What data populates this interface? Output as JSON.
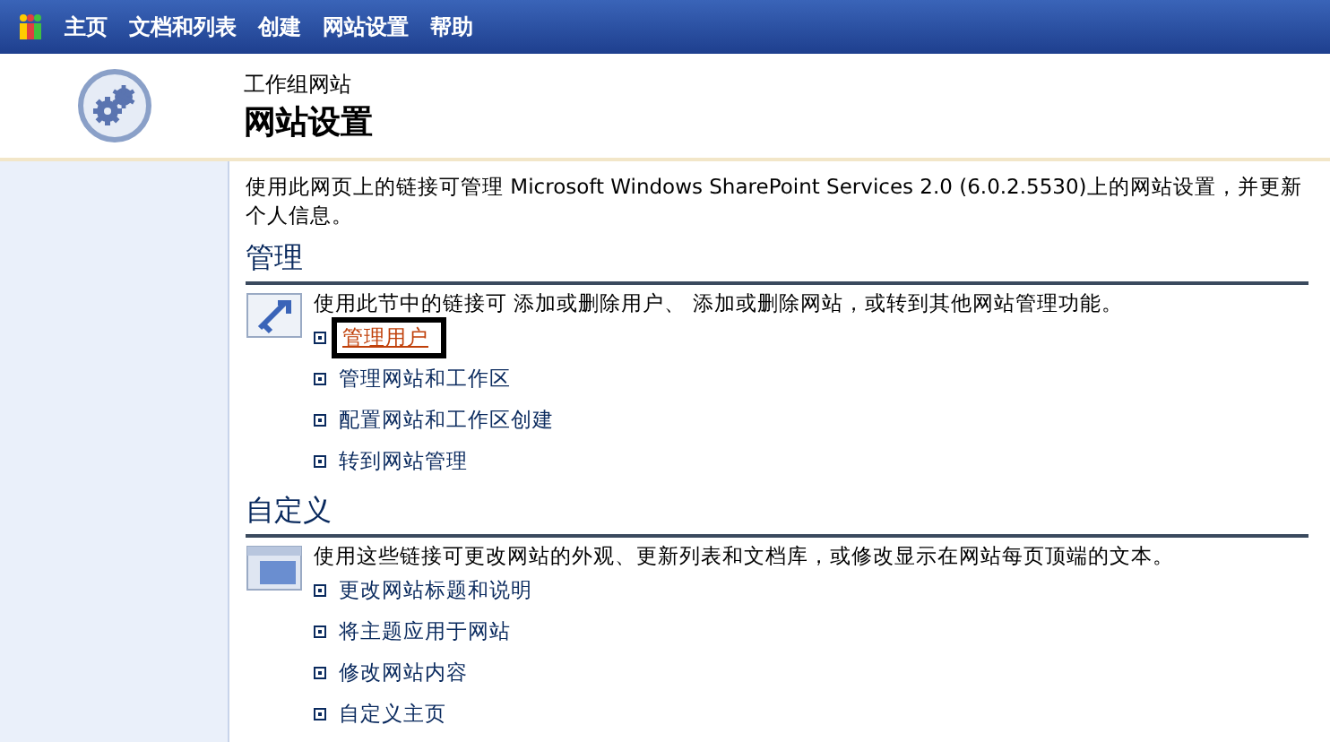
{
  "nav": {
    "items": [
      "主页",
      "文档和列表",
      "创建",
      "网站设置",
      "帮助"
    ]
  },
  "header": {
    "site": "工作组网站",
    "title": "网站设置"
  },
  "intro": "使用此网页上的链接可管理 Microsoft Windows SharePoint Services 2.0 (6.0.2.5530)上的网站设置，并更新个人信息。",
  "sections": [
    {
      "title": "管理",
      "kind": "manage",
      "description": "使用此节中的链接可 添加或删除用户、 添加或删除网站，或转到其他网站管理功能。",
      "links": [
        {
          "label": "管理用户",
          "selected": true
        },
        {
          "label": "管理网站和工作区",
          "selected": false
        },
        {
          "label": "配置网站和工作区创建",
          "selected": false
        },
        {
          "label": "转到网站管理",
          "selected": false
        }
      ]
    },
    {
      "title": "自定义",
      "kind": "customize",
      "description": "使用这些链接可更改网站的外观、更新列表和文档库，或修改显示在网站每页顶端的文本。",
      "links": [
        {
          "label": "更改网站标题和说明",
          "selected": false
        },
        {
          "label": "将主题应用于网站",
          "selected": false
        },
        {
          "label": "修改网站内容",
          "selected": false
        },
        {
          "label": "自定义主页",
          "selected": false
        }
      ]
    }
  ]
}
